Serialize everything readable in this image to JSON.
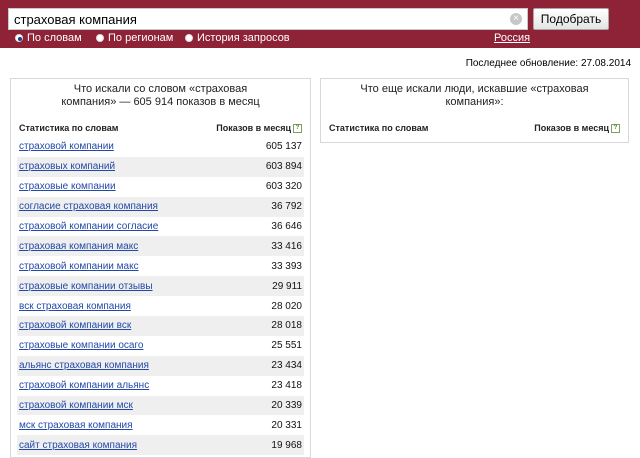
{
  "search": {
    "query": "страховая компания",
    "button_label": "Подобрать"
  },
  "modes": [
    {
      "label": "По словам",
      "active": true
    },
    {
      "label": "По регионам",
      "active": false
    },
    {
      "label": "История запросов",
      "active": false
    }
  ],
  "region": "Россия",
  "last_update": "Последнее обновление: 27.08.2014",
  "left_panel": {
    "title_line1": "Что искали со словом «страховая",
    "title_line2": "компания» — 605 914 показов в месяц",
    "col_keyword": "Статистика по словам",
    "col_count": "Показов в месяц",
    "rows": [
      {
        "keyword": "страховой компании",
        "count": "605 137"
      },
      {
        "keyword": "страховых компаний",
        "count": "603 894"
      },
      {
        "keyword": "страховые компании",
        "count": "603 320"
      },
      {
        "keyword": "согласие страховая компания",
        "count": "36 792"
      },
      {
        "keyword": "страховой компании согласие",
        "count": "36 646"
      },
      {
        "keyword": "страховая компания макс",
        "count": "33 416"
      },
      {
        "keyword": "страховой компании макс",
        "count": "33 393"
      },
      {
        "keyword": "страховые компании отзывы",
        "count": "29 911"
      },
      {
        "keyword": "вск страховая компания",
        "count": "28 020"
      },
      {
        "keyword": "страховой компании вск",
        "count": "28 018"
      },
      {
        "keyword": "страховые компании осаго",
        "count": "25 551"
      },
      {
        "keyword": "альянс страховая компания",
        "count": "23 434"
      },
      {
        "keyword": "страховой компании альянс",
        "count": "23 418"
      },
      {
        "keyword": "страховой компании мск",
        "count": "20 339"
      },
      {
        "keyword": "мск страховая компания",
        "count": "20 331"
      },
      {
        "keyword": "сайт страховая компания",
        "count": "19 968"
      }
    ]
  },
  "right_panel": {
    "title_line1": "Что еще искали люди, искавшие «страховая",
    "title_line2": "компания»:",
    "col_keyword": "Статистика по словам",
    "col_count": "Показов в месяц"
  },
  "icons": {
    "help": "?",
    "clear": "×"
  }
}
